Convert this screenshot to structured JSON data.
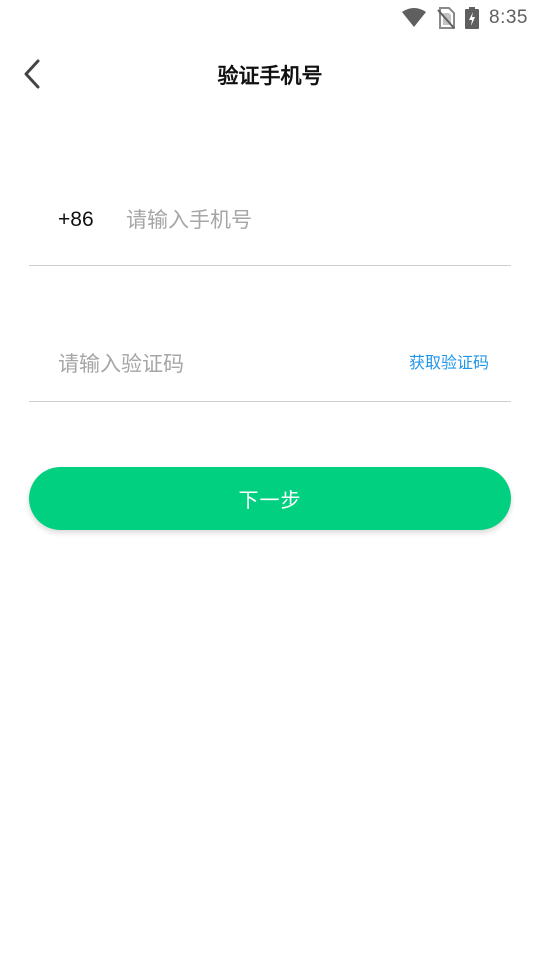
{
  "status_bar": {
    "time": "8:35",
    "icons": [
      "wifi-icon",
      "no-sim-icon",
      "battery-charging-icon"
    ]
  },
  "header": {
    "back_icon": "chevron-left-icon",
    "title": "验证手机号"
  },
  "phone": {
    "country_code": "+86",
    "value": "",
    "placeholder": "请输入手机号"
  },
  "verification": {
    "value": "",
    "placeholder": "请输入验证码",
    "get_code_label": "获取验证码"
  },
  "actions": {
    "next_label": "下一步"
  },
  "colors": {
    "accent_green": "#02d081",
    "link_blue": "#2196e8",
    "placeholder_gray": "#a6a6a6",
    "divider": "#cfcfcf"
  }
}
